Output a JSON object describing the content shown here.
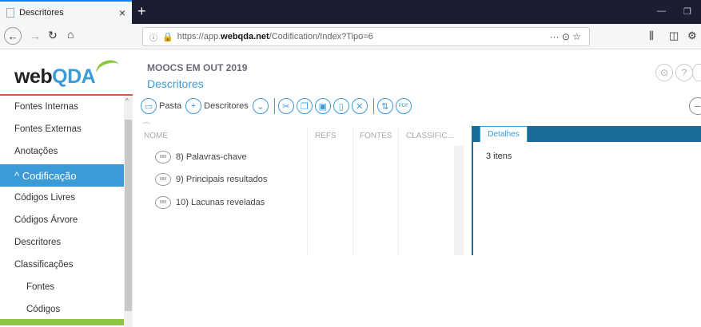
{
  "browser": {
    "tab_title": "Descritores",
    "tab_close": "×",
    "new_tab": "+",
    "url_prefix": "https://app.",
    "url_domain": "webqda.net",
    "url_path": "/Codification/Index?Tipo=6",
    "url_actions": "··· ⊙ ☆",
    "toolbar_icons": [
      "library-icon",
      "sidebar-icon",
      "account-icon"
    ]
  },
  "app": {
    "logo_web": "web",
    "logo_qda": "QDA",
    "project_name": "MOOCS EM OUT 2019",
    "section_name": "Descritores"
  },
  "sidebar": {
    "items": [
      {
        "label": "Fontes Internas"
      },
      {
        "label": "Fontes Externas"
      },
      {
        "label": "Anotações"
      },
      {
        "label": "^ Codificação",
        "active": true
      },
      {
        "label": "Códigos Livres"
      },
      {
        "label": "Códigos Árvore"
      },
      {
        "label": "Descritores"
      },
      {
        "label": "Classificações"
      },
      {
        "label": "Fontes"
      },
      {
        "label": "Códigos"
      }
    ]
  },
  "toolbar": {
    "pasta_label": "Pasta",
    "descritores_label": "Descritores",
    "pdf_label": "PDF"
  },
  "tree": {
    "columns": [
      "NOME",
      "REFS",
      "FONTES",
      "CLASSIFIC..."
    ],
    "rows": [
      {
        "badge": "888",
        "label": "8) Palavras-chave"
      },
      {
        "badge": "888",
        "label": "9) Principais resultados"
      },
      {
        "badge": "888",
        "label": "10) Lacunas reveladas"
      }
    ]
  },
  "details": {
    "tab_label": "Detalhes",
    "count": "3 itens"
  },
  "colors": {
    "accent": "#3a9bd6",
    "dark_blue": "#1a6c9a",
    "green": "#8dc63f",
    "red": "#d9534f"
  }
}
